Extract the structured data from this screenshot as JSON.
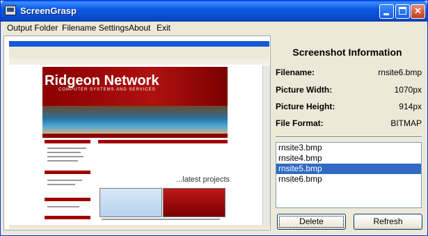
{
  "window": {
    "title": "ScreenGrasp"
  },
  "menu": {
    "items": [
      "Output Folder",
      "Filename Settings",
      "About",
      "Exit"
    ]
  },
  "preview": {
    "site_name": "Ridgeon Network",
    "site_tagline": "COMPUTER SYSTEMS AND SERVICES",
    "projects_heading_accent": "...latest",
    "projects_heading": " projects"
  },
  "info": {
    "title": "Screenshot Information",
    "rows": [
      {
        "label": "Filename:",
        "value": "rnsite6.bmp"
      },
      {
        "label": "Picture Width:",
        "value": "1070px"
      },
      {
        "label": "Picture Height:",
        "value": "914px"
      },
      {
        "label": "File Format:",
        "value": "BITMAP"
      }
    ]
  },
  "files": {
    "items": [
      "rnsite3.bmp",
      "rnsite4.bmp",
      "rnsite5.bmp",
      "rnsite6.bmp"
    ],
    "selected": "rnsite5.bmp"
  },
  "buttons": {
    "delete_label": "Delete",
    "refresh_label": "Refresh"
  },
  "icons": {
    "app": "app-window-icon",
    "minimize": "minimize-icon",
    "maximize": "maximize-icon",
    "close": "close-icon"
  },
  "colors": {
    "titlebar": "#0b59e3",
    "selection": "#316ac5",
    "close": "#c63c17"
  }
}
